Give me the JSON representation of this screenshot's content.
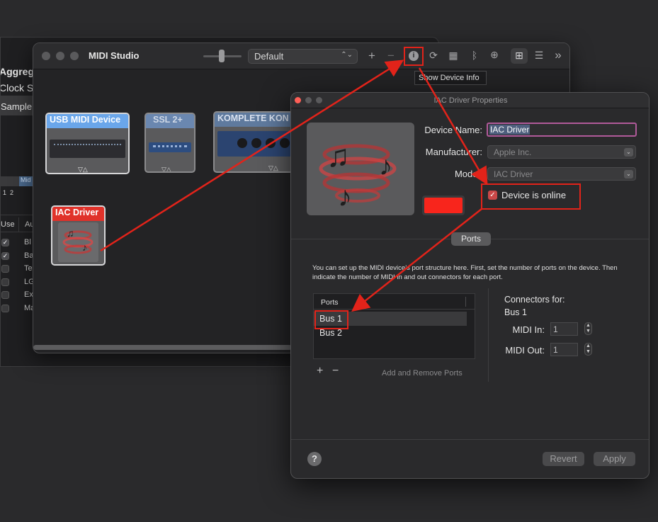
{
  "background_window": {
    "labels": [
      "Aggrega",
      "Clock So",
      "Sample"
    ],
    "track_label": "Mid",
    "track_numbers": [
      "1",
      "2"
    ],
    "column_use": "Use",
    "column_a": "Au",
    "rows": [
      {
        "checked": true,
        "label": "Bl"
      },
      {
        "checked": true,
        "label": "Ba"
      },
      {
        "checked": false,
        "label": "Te"
      },
      {
        "checked": false,
        "label": "LG"
      },
      {
        "checked": false,
        "label": "Ex"
      },
      {
        "checked": false,
        "label": "Ma"
      }
    ]
  },
  "midi_studio": {
    "title": "MIDI Studio",
    "configuration": "Default",
    "toolbar": {
      "add": "+",
      "remove": "−",
      "info": "i",
      "rescan": "⟳",
      "keyboard": "▦",
      "bluetooth": "ᛒ",
      "network": "⊕",
      "icon_view": "⊞",
      "list_view": "☰",
      "more": "»"
    },
    "devices": [
      {
        "name": "USB MIDI Device",
        "header_color": "#6aa6ea"
      },
      {
        "name": "SSL 2+",
        "header_color": "#6a87b0"
      },
      {
        "name": "KOMPLETE KON",
        "header_color": "#5f7a9e"
      },
      {
        "name": "IAC Driver",
        "header_color": "#e0322a"
      }
    ]
  },
  "tooltip": "Show Device Info",
  "properties": {
    "title": "IAC Driver Properties",
    "device_name_label": "Device Name:",
    "device_name": "IAC Driver",
    "manufacturer_label": "Manufacturer:",
    "manufacturer": "Apple Inc.",
    "model_label": "Model:",
    "model": "IAC Driver",
    "online_label": "Device is online",
    "online_checked": true,
    "color_swatch": "#f8251c",
    "ports_button": "Ports",
    "description": "You can set up the MIDI device’s port structure here. First, set the number of ports on the device. Then indicate the number of MIDI in and out connectors for each port.",
    "ports_header": "Ports",
    "ports": [
      "Bus 1",
      "Bus 2"
    ],
    "add_port": "+",
    "remove_port": "−",
    "add_remove_label": "Add and Remove Ports",
    "connectors_for_label": "Connectors for:",
    "connectors_for": "Bus 1",
    "midi_in_label": "MIDI In:",
    "midi_in": "1",
    "midi_out_label": "MIDI Out:",
    "midi_out": "1",
    "help": "?",
    "revert": "Revert",
    "apply": "Apply"
  },
  "annotation_color": "#e2231a"
}
